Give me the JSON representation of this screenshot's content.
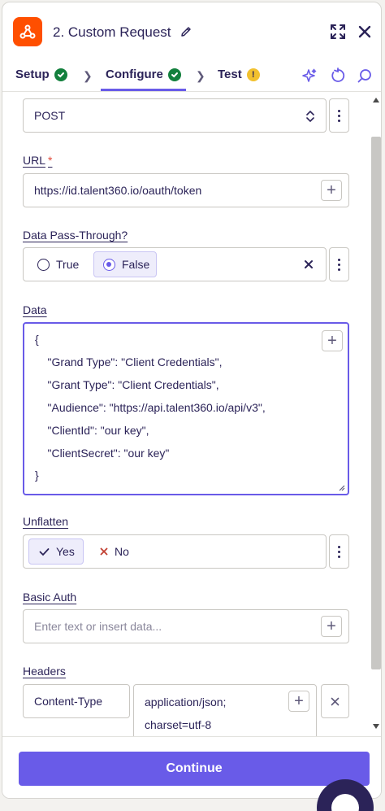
{
  "header": {
    "title": "2. Custom Request",
    "icons": {
      "app": "webhook-icon",
      "edit": "pencil-icon",
      "expand": "expand-icon",
      "close": "close-icon"
    }
  },
  "tabs": [
    {
      "label": "Setup",
      "status": "complete"
    },
    {
      "label": "Configure",
      "status": "complete",
      "active": true
    },
    {
      "label": "Test",
      "status": "warning"
    }
  ],
  "tab_actions": [
    "ai-sparkle-icon",
    "refresh-icon",
    "search-icon"
  ],
  "method": {
    "value": "POST"
  },
  "url": {
    "label": "URL",
    "required_mark": "*",
    "value": "https://id.talent360.io/oauth/token"
  },
  "passthrough": {
    "label": "Data Pass-Through?",
    "options": [
      {
        "label": "True",
        "selected": false
      },
      {
        "label": "False",
        "selected": true
      }
    ]
  },
  "data": {
    "label": "Data",
    "lines": [
      "{",
      "    \"Grand Type\": \"Client Credentials\",",
      "    \"Grant Type\": \"Client Credentials\",",
      "    \"Audience\": \"https://api.talent360.io/api/v3\",",
      "    \"ClientId\": \"our key\",",
      "    \"ClientSecret\": \"our key\"",
      "}"
    ]
  },
  "unflatten": {
    "label": "Unflatten",
    "options": [
      {
        "label": "Yes",
        "selected": true
      },
      {
        "label": "No",
        "selected": false
      }
    ]
  },
  "basic_auth": {
    "label": "Basic Auth",
    "placeholder": "Enter text or insert data..."
  },
  "headers": {
    "label": "Headers",
    "rows": [
      {
        "key": "Content-Type",
        "value_line1": "application/json;",
        "value_line2": "charset=utf-8"
      }
    ]
  },
  "footer": {
    "continue_label": "Continue"
  },
  "colors": {
    "accent": "#695be8",
    "brand": "#ff4f00",
    "success": "#13803d",
    "warning": "#f2c12e",
    "text": "#2b2358"
  }
}
